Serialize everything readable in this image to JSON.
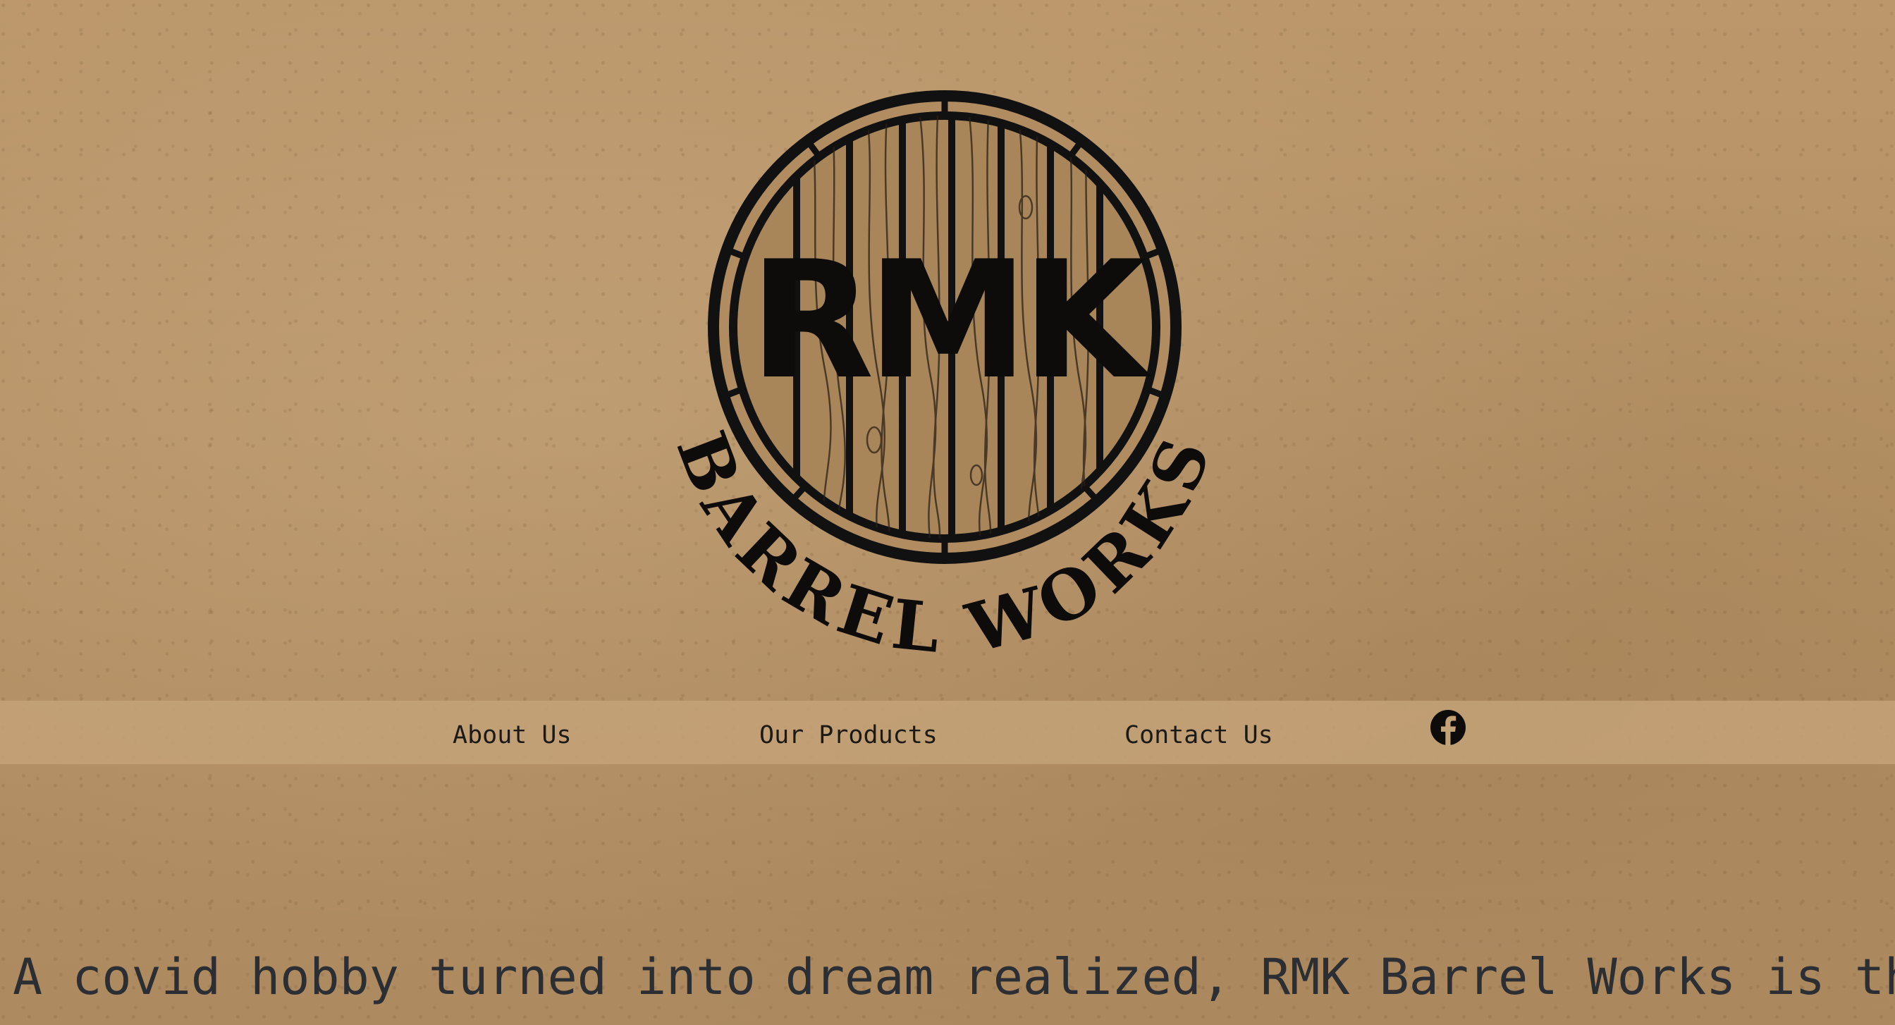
{
  "site": {
    "logo": {
      "monogram": "RMK",
      "arc_text": "BARREL WORKS",
      "alt": "RMK Barrel Works logo"
    }
  },
  "nav": {
    "items": [
      {
        "label": "About Us"
      },
      {
        "label": "Our Products"
      },
      {
        "label": "Contact Us"
      }
    ],
    "social_icon": "facebook-icon"
  },
  "hero": {
    "tagline": "A covid hobby turned into dream realized,  RMK Barrel Works is the"
  },
  "colors": {
    "background": "#b89468",
    "nav_band": "#c4a278",
    "ink": "#1c1a17",
    "tagline_text": "#2b2e33"
  }
}
